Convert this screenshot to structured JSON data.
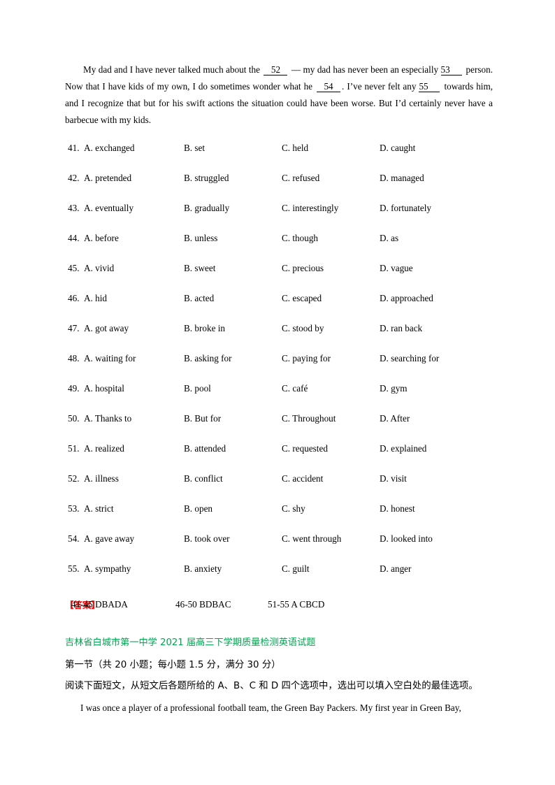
{
  "passage": {
    "line1_pre": "My dad and I have never talked much about the",
    "blank_52": "52",
    "line1_post": "— my dad has never been an especially",
    "blank_53": "53",
    "line2": "person. Now that I have kids of my own, I do sometimes wonder what he",
    "blank_54": "54",
    "line2_post": ". I’ve never felt any",
    "blank_55": "55",
    "line3": "towards him, and I recognize that but for his swift actions the situation could have been worse. But I’d certainly never have a barbecue with my kids."
  },
  "options": [
    {
      "num": "41.",
      "a": "A. exchanged",
      "b": "B. set",
      "c": "C. held",
      "d": "D. caught"
    },
    {
      "num": "42.",
      "a": "A. pretended",
      "b": "B. struggled",
      "c": "C. refused",
      "d": "D. managed"
    },
    {
      "num": "43.",
      "a": "A. eventually",
      "b": "B. gradually",
      "c": "C. interestingly",
      "d": "D. fortunately"
    },
    {
      "num": "44.",
      "a": "A. before",
      "b": "B. unless",
      "c": "C. though",
      "d": "D. as"
    },
    {
      "num": "45.",
      "a": "A. vivid",
      "b": "B. sweet",
      "c": "C. precious",
      "d": "D. vague"
    },
    {
      "num": "46.",
      "a": "A. hid",
      "b": "B. acted",
      "c": "C. escaped",
      "d": "D. approached"
    },
    {
      "num": "47.",
      "a": "A. got away",
      "b": "B. broke in",
      "c": "C. stood by",
      "d": "D. ran back"
    },
    {
      "num": "48.",
      "a": "A. waiting for",
      "b": "B. asking for",
      "c": "C. paying for",
      "d": "D. searching for"
    },
    {
      "num": "49.",
      "a": "A. hospital",
      "b": "B. pool",
      "c": "C. café",
      "d": "D. gym"
    },
    {
      "num": "50.",
      "a": "A. Thanks to",
      "b": "B. But for",
      "c": "C. Throughout",
      "d": "D. After"
    },
    {
      "num": "51.",
      "a": "A. realized",
      "b": "B. attended",
      "c": "C. requested",
      "d": "D. explained"
    },
    {
      "num": "52.",
      "a": "A. illness",
      "b": "B. conflict",
      "c": "C. accident",
      "d": "D. visit"
    },
    {
      "num": "53.",
      "a": "A. strict",
      "b": "B. open",
      "c": "C. shy",
      "d": "D. honest"
    },
    {
      "num": "54.",
      "a": "A. gave away",
      "b": "B. took over",
      "c": "C. went through",
      "d": "D. looked into"
    },
    {
      "num": "55.",
      "a": "A. sympathy",
      "b": "B. anxiety",
      "c": "C. guilt",
      "d": "D. anger"
    }
  ],
  "answer_key": {
    "tag": "【答案】",
    "group1": "41-45 DBADA",
    "group2": "46-50 BDBAC",
    "group3": "51-55 A CBCD"
  },
  "source_title": "吉林省白城市第一中学 2021 届高三下学期质量检测英语试题",
  "section": {
    "heading": "第一节（共 20 小题；每小题 1.5 分，满分 30 分）",
    "instruction": "阅读下面短文，从短文后各题所给的 A、B、C 和 D 四个选项中，选出可以填入空白处的最佳选项。"
  },
  "next_passage": {
    "line1": "I was once a player of a professional football team, the Green Bay Packers. My first year in Green Bay,"
  },
  "colors": {
    "answer_tag": "#ff0000",
    "source_title": "#00a650",
    "text": "#000000"
  }
}
